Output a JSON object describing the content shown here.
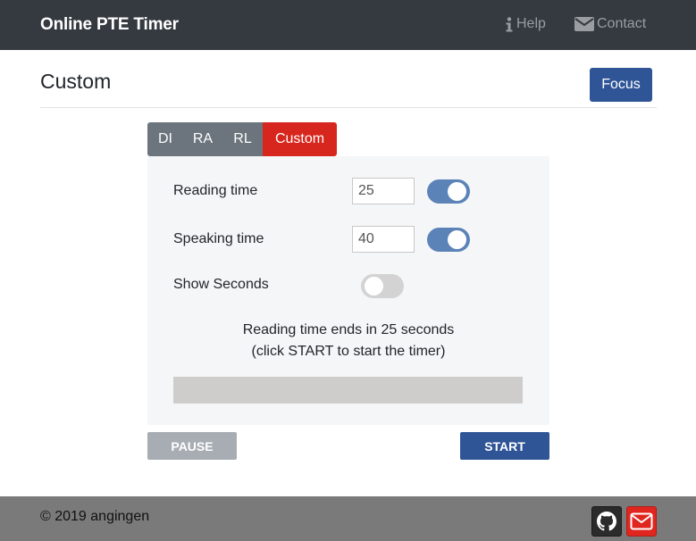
{
  "navbar": {
    "brand": "Online PTE Timer",
    "help_label": "Help",
    "help_icon": "info-icon",
    "contact_label": "Contact",
    "contact_icon": "envelope-icon",
    "background_color": "#343a40"
  },
  "page": {
    "title": "Custom",
    "focus_label": "Focus"
  },
  "tabs": [
    {
      "label": "DI",
      "active": false
    },
    {
      "label": "RA",
      "active": false
    },
    {
      "label": "RL",
      "active": false
    },
    {
      "label": "Custom",
      "active": true
    }
  ],
  "settings": {
    "reading_time": {
      "label": "Reading time",
      "value": "25",
      "enabled": true
    },
    "speaking_time": {
      "label": "Speaking time",
      "value": "40",
      "enabled": true
    },
    "show_seconds": {
      "label": "Show Seconds",
      "enabled": false
    }
  },
  "status": {
    "line1": "Reading time ends in 25 seconds",
    "line2": "(click START to start the timer)",
    "progress_fraction": 0
  },
  "controls": {
    "pause_label": "PAUSE",
    "start_label": "START"
  },
  "footer": {
    "copyright": "© 2019 angingen",
    "github_icon": "github-icon",
    "mail_icon": "mail-icon"
  },
  "colors": {
    "accent": "#2f5597",
    "active_tab": "#d7261e",
    "toggle_on": "#5c83b8"
  }
}
